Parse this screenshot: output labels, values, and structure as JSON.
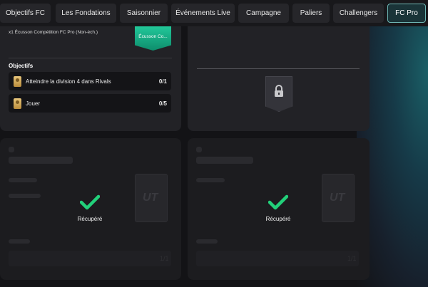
{
  "tabs": [
    {
      "label": "Objectifs FC",
      "active": false
    },
    {
      "label": "Les Fondations",
      "active": false
    },
    {
      "label": "Saisonnier",
      "active": false
    },
    {
      "label": "Événements Live",
      "active": false
    },
    {
      "label": "Campagne",
      "active": false
    },
    {
      "label": "Paliers",
      "active": false
    },
    {
      "label": "Challengers",
      "active": false
    },
    {
      "label": "FC Pro",
      "active": true
    }
  ],
  "reward_card": {
    "reward_text": "x1 Écusson Compétition FC Pro (Non-éch.)",
    "badge_label": "Écusson Co...",
    "objectives_heading": "Objectifs",
    "objectives": [
      {
        "label": "Atteindre la division 4 dans Rivals",
        "progress": "0/1",
        "icon": "medal-icon"
      },
      {
        "label": "Jouer",
        "progress": "0/5",
        "icon": "medal-icon"
      }
    ]
  },
  "locked_card": {
    "icon": "lock-icon"
  },
  "claimed_cards": [
    {
      "status": "Récupéré",
      "progress": "1/1"
    },
    {
      "status": "Récupéré",
      "progress": "1/1"
    }
  ],
  "colors": {
    "accent_teal": "#6fb8b6",
    "check_green": "#22d07a",
    "badge_green": "#17b088"
  }
}
